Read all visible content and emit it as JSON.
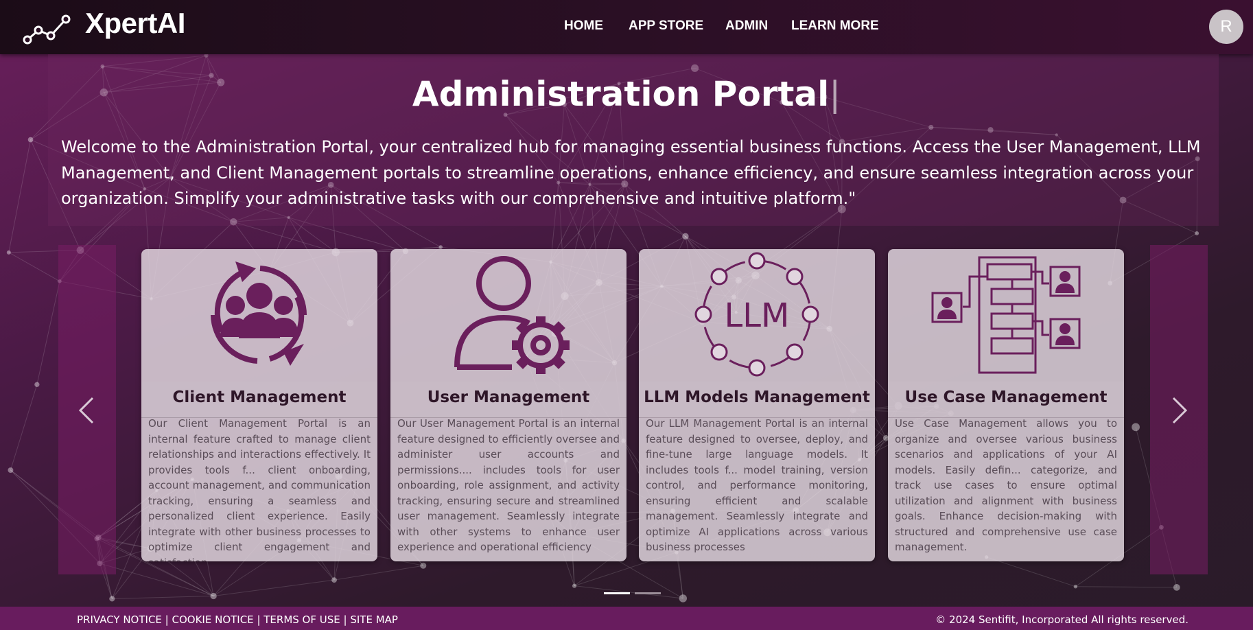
{
  "header": {
    "brand": "XpertAI",
    "nav": [
      "HOME",
      "APP STORE",
      "ADMIN",
      "LEARN MORE"
    ],
    "avatar_initial": "R"
  },
  "hero": {
    "title": "Administration Portal",
    "cursor": "|",
    "description": "Welcome to the Administration Portal, your centralized hub for managing essential business functions. Access the User Management, LLM Management, and Client Management portals to streamline operations, enhance efficiency, and ensure seamless integration across your organization. Simplify your administrative tasks with our comprehensive and intuitive platform.\""
  },
  "cards": [
    {
      "title": "Client Management",
      "icon": "client-group-icon",
      "description": "Our Client Management Portal is an internal feature crafted to manage client relationships and interactions effectively. It provides tools f... client onboarding, account management, and communication tracking, ensuring a seamless and personalized client experience. Easily integrate with other business processes to optimize client engagement and satisfaction"
    },
    {
      "title": "User Management",
      "icon": "user-gear-icon",
      "description": "Our User Management Portal is an internal feature designed to efficiently oversee and administer user accounts and permissions.... includes tools for user onboarding, role assignment, and activity tracking, ensuring secure and streamlined user management. Seamlessly integrate with other systems to enhance user experience and operational efficiency"
    },
    {
      "title": "LLM Models Management",
      "icon": "llm-network-icon",
      "icon_text": "LLM",
      "description": "Our LLM Management Portal is an internal feature designed to oversee, deploy, and fine-tune large language models. It includes tools f... model training, version control, and performance monitoring, ensuring efficient and scalable management. Seamlessly integrate and optimize AI applications across various business processes"
    },
    {
      "title": "Use Case Management",
      "icon": "workflow-icon",
      "description": "Use Case Management allows you to organize and oversee various business scenarios and applications of your AI models. Easily defin... categorize, and track use cases to ensure optimal utilization and alignment with business goals. Enhance decision-making with structured and comprehensive use case management."
    }
  ],
  "footer": {
    "links": [
      "PRIVACY NOTICE",
      "COOKIE NOTICE",
      "TERMS OF USE",
      "SITE MAP"
    ],
    "separator": " | ",
    "copyright": "© 2024 Sentifit, Incorporated All rights reserved."
  },
  "colors": {
    "accent": "#681c5e",
    "icon": "#6a1f5c",
    "navbar": "#1b0c17"
  },
  "carousel": {
    "slides": 2,
    "active": 0
  }
}
